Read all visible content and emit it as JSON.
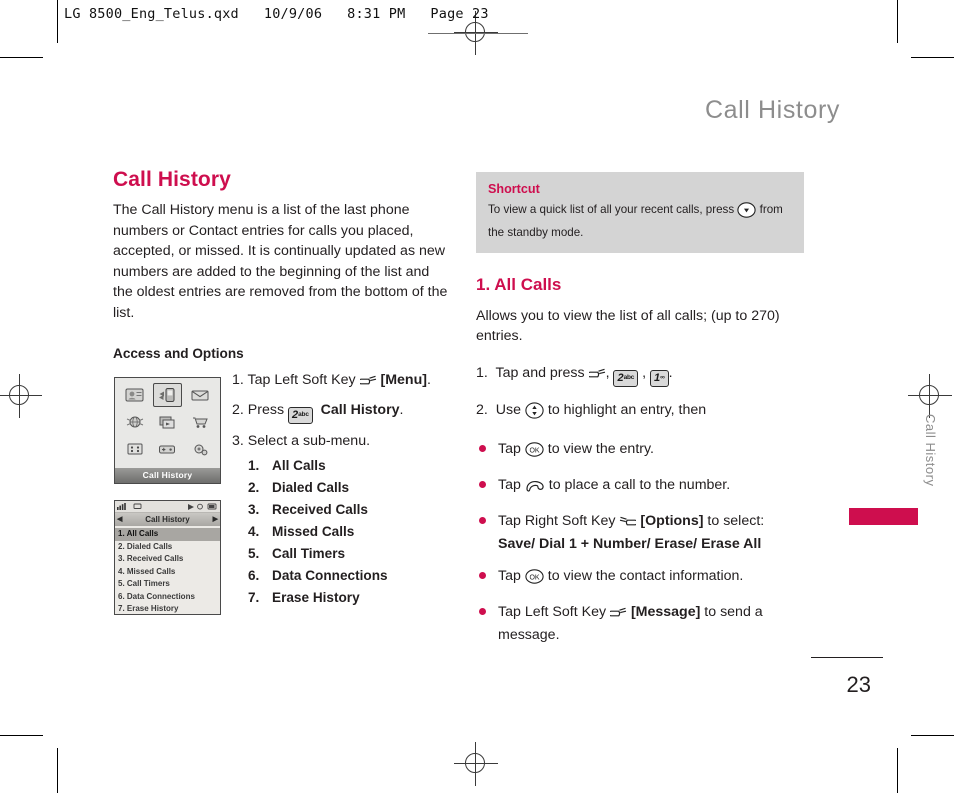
{
  "print_header": {
    "text": "LG 8500_Eng_Telus.qxd   10/9/06   8:31 PM   Page 23"
  },
  "running_head": "Call History",
  "colors": {
    "accent": "#ce0e4e",
    "body_text": "#231f20",
    "running_head": "#8d8d8d",
    "shortcut_bg": "#d4d4d4"
  },
  "left_column": {
    "section_title": "Call History",
    "intro": "The Call History menu is a list of the last phone numbers or Contact entries for calls you placed, accepted, or missed. It is continually updated as new numbers are added to the beginning of the list and the oldest entries are removed from the bottom of the list.",
    "subhead": "Access and Options",
    "steps": [
      {
        "num": "1.",
        "pre": "Tap Left Soft Key",
        "icon": "left-soft-key-icon",
        "bold": "[Menu]",
        "post": "."
      },
      {
        "num": "2.",
        "pre": "Press",
        "icon": "key-2-abc",
        "key_digit": "2",
        "key_sup": "abc",
        "bold": "Call History",
        "post": "."
      },
      {
        "num": "3.",
        "pre": "Select a sub-menu.",
        "icon": "",
        "bold": "",
        "post": ""
      }
    ],
    "submenu": [
      {
        "num": "1.",
        "label": "All Calls"
      },
      {
        "num": "2.",
        "label": "Dialed Calls"
      },
      {
        "num": "3.",
        "label": "Received Calls"
      },
      {
        "num": "4.",
        "label": "Missed Calls"
      },
      {
        "num": "5.",
        "label": "Call Timers"
      },
      {
        "num": "6.",
        "label": "Data Connections"
      },
      {
        "num": "7.",
        "label": "Erase History"
      }
    ]
  },
  "phone_grid_screen": {
    "label": "Call History",
    "icons": [
      "contacts-icon",
      "call-history-icon",
      "messaging-icon",
      "web-icon",
      "media-icon",
      "shop-icon",
      "tools-icon",
      "games-icon",
      "settings-icon"
    ],
    "selected_index": 1
  },
  "phone_list_screen": {
    "title": "Call History",
    "items": [
      "1. All Calls",
      "2. Dialed Calls",
      "3. Received Calls",
      "4. Missed Calls",
      "5. Call Timers",
      "6. Data Connections",
      "7. Erase History"
    ],
    "selected_index": 0
  },
  "right_column": {
    "shortcut": {
      "title": "Shortcut",
      "text_before": "To view a quick list of all your recent calls, press",
      "icon": "down-navigation-key-icon",
      "text_after": "from the standby mode."
    },
    "section_title": "1. All Calls",
    "intro": "Allows you to view the list of all calls; (up to 270) entries.",
    "step1": {
      "num": "1.",
      "pre": "Tap and press",
      "icon": "left-soft-key-icon",
      "key1_digit": "2",
      "key1_sup": "abc",
      "key2_digit": "1",
      "key2_sup": "∞",
      "post": "."
    },
    "step2": {
      "num": "2.",
      "pre": "Use",
      "icon": "up-down-navigation-key-icon",
      "post": "to highlight an entry, then"
    },
    "bullets": [
      {
        "pre": "Tap",
        "icon": "ok-key-icon",
        "mid": "to view the entry.",
        "bold": "",
        "post": ""
      },
      {
        "pre": "Tap",
        "icon": "send-call-key-icon",
        "mid": "to place a call to the number.",
        "bold": "",
        "post": ""
      },
      {
        "pre": "Tap Right Soft Key",
        "icon": "right-soft-key-icon",
        "bold": "[Options]",
        "mid": "to select:",
        "sub_bold": "Save/ Dial 1 + Number/ Erase/ Erase All",
        "post": ""
      },
      {
        "pre": "Tap",
        "icon": "ok-key-icon",
        "mid": "to view the contact information.",
        "bold": "",
        "post": ""
      },
      {
        "pre": "Tap Left Soft Key",
        "icon": "left-soft-key-icon",
        "bold": "[Message]",
        "mid": "to send a message.",
        "post": ""
      }
    ]
  },
  "side_tab": {
    "vertical_label": "Call History"
  },
  "page_number": "23"
}
